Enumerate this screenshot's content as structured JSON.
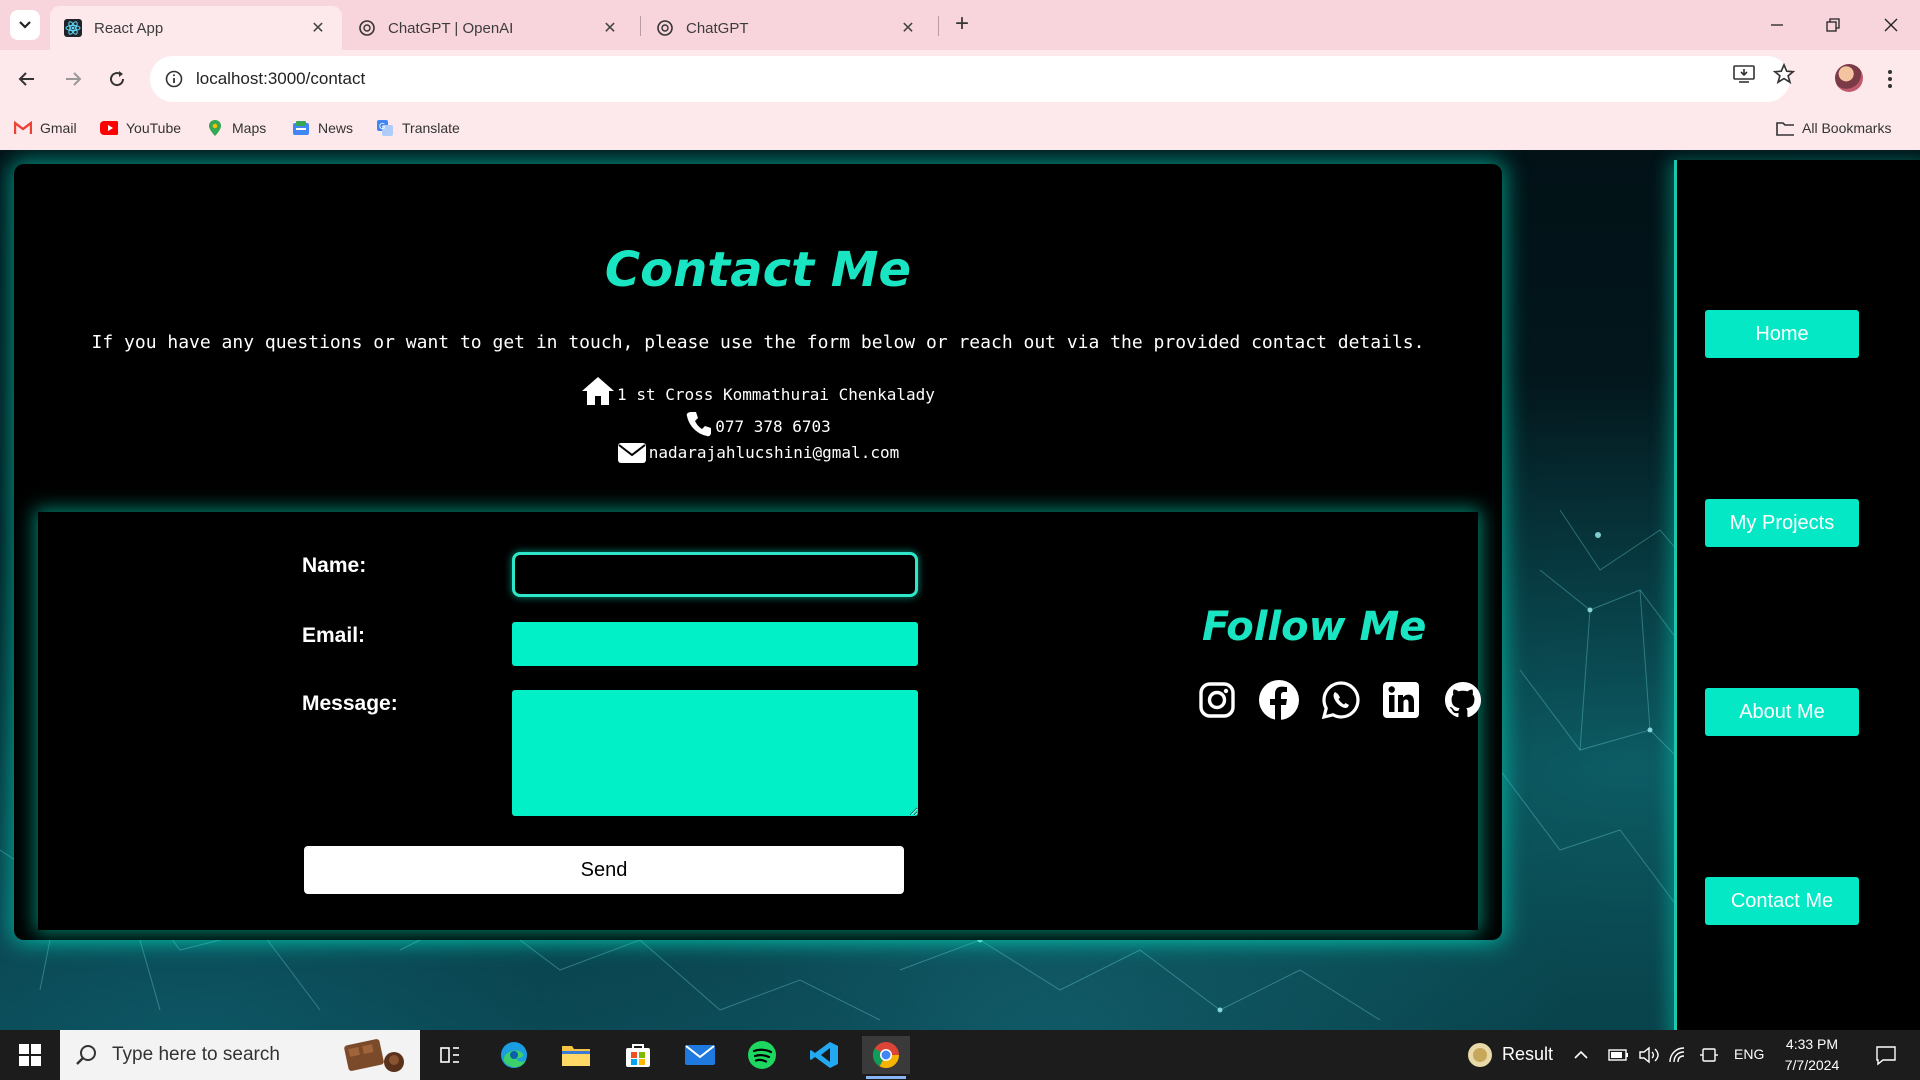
{
  "browser": {
    "tabs": [
      {
        "title": "React App",
        "active": true,
        "icon": "react-icon"
      },
      {
        "title": "ChatGPT | OpenAI",
        "active": false,
        "icon": "openai-icon"
      },
      {
        "title": "ChatGPT",
        "active": false,
        "icon": "openai-icon"
      }
    ],
    "url": "localhost:3000/contact",
    "bookmarks": [
      {
        "label": "Gmail",
        "icon": "gmail-icon"
      },
      {
        "label": "YouTube",
        "icon": "youtube-icon"
      },
      {
        "label": "Maps",
        "icon": "maps-icon"
      },
      {
        "label": "News",
        "icon": "news-icon"
      },
      {
        "label": "Translate",
        "icon": "translate-icon"
      }
    ],
    "all_bookmarks": "All Bookmarks"
  },
  "contact": {
    "title": "Contact Me",
    "intro": "If you have any questions or want to get in touch, please use the form below or reach out via the provided contact details.",
    "address": "1 st Cross Kommathurai Chenkalady",
    "phone": "077 378 6703",
    "email": "nadarajahlucshini@gmal.com"
  },
  "form": {
    "name_label": "Name:",
    "email_label": "Email:",
    "message_label": "Message:",
    "name_value": "",
    "email_value": "",
    "message_value": "",
    "send_label": "Send"
  },
  "follow": {
    "title": "Follow Me",
    "icons": [
      "instagram-icon",
      "facebook-icon",
      "whatsapp-icon",
      "linkedin-icon",
      "github-icon"
    ]
  },
  "nav": {
    "items": [
      "Home",
      "My Projects",
      "About Me",
      "Contact Me"
    ]
  },
  "taskbar": {
    "search_placeholder": "Type here to search",
    "widget_label": "Result",
    "language": "ENG",
    "time": "4:33 PM",
    "date": "7/7/2024"
  },
  "colors": {
    "accent": "#05e8c6",
    "tabbar": "#f8d5dc",
    "toolbar": "#fde9ec"
  }
}
